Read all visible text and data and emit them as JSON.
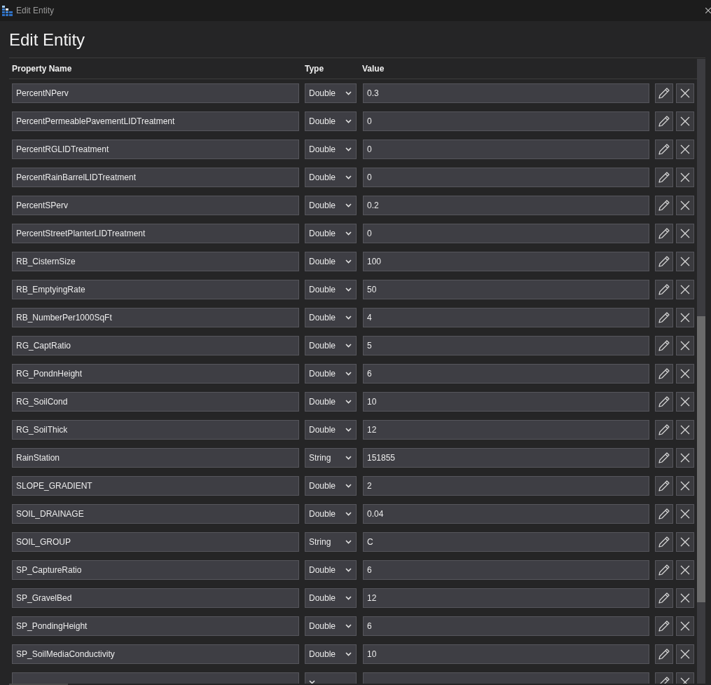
{
  "window": {
    "title": "Edit Entity"
  },
  "heading": "Edit Entity",
  "table": {
    "columns": [
      "Property Name",
      "Type",
      "Value"
    ],
    "rows": [
      {
        "kind": "full",
        "name": "PercentNPerv",
        "type": "Double",
        "value": "0.3"
      },
      {
        "kind": "full",
        "name": "PercentPermeablePavementLIDTreatment",
        "type": "Double",
        "value": "0"
      },
      {
        "kind": "full",
        "name": "PercentRGLIDTreatment",
        "type": "Double",
        "value": "0"
      },
      {
        "kind": "full",
        "name": "PercentRainBarrelLIDTreatment",
        "type": "Double",
        "value": "0"
      },
      {
        "kind": "full",
        "name": "PercentSPerv",
        "type": "Double",
        "value": "0.2"
      },
      {
        "kind": "full",
        "name": "PercentStreetPlanterLIDTreatment",
        "type": "Double",
        "value": "0"
      },
      {
        "kind": "full",
        "name": "RB_CisternSize",
        "type": "Double",
        "value": "100"
      },
      {
        "kind": "full",
        "name": "RB_EmptyingRate",
        "type": "Double",
        "value": "50"
      },
      {
        "kind": "full",
        "name": "RB_NumberPer1000SqFt",
        "type": "Double",
        "value": "4"
      },
      {
        "kind": "full",
        "name": "RG_CaptRatio",
        "type": "Double",
        "value": "5"
      },
      {
        "kind": "full",
        "name": "RG_PondnHeight",
        "type": "Double",
        "value": "6"
      },
      {
        "kind": "full",
        "name": "RG_SoilCond",
        "type": "Double",
        "value": "10"
      },
      {
        "kind": "full",
        "name": "RG_SoilThick",
        "type": "Double",
        "value": "12"
      },
      {
        "kind": "full",
        "name": "RainStation",
        "type": "String",
        "value": "151855"
      },
      {
        "kind": "full",
        "name": "SLOPE_GRADIENT",
        "type": "Double",
        "value": "2"
      },
      {
        "kind": "full",
        "name": "SOIL_DRAINAGE",
        "type": "Double",
        "value": "0.04"
      },
      {
        "kind": "full",
        "name": "SOIL_GROUP",
        "type": "String",
        "value": "C"
      },
      {
        "kind": "full",
        "name": "SP_CaptureRatio",
        "type": "Double",
        "value": "6"
      },
      {
        "kind": "full",
        "name": "SP_GravelBed",
        "type": "Double",
        "value": "12"
      },
      {
        "kind": "full",
        "name": "SP_PondingHeight",
        "type": "Double",
        "value": "6"
      },
      {
        "kind": "full",
        "name": "SP_SoilMediaConductivity",
        "type": "Double",
        "value": "10"
      },
      {
        "kind": "cut"
      }
    ]
  }
}
